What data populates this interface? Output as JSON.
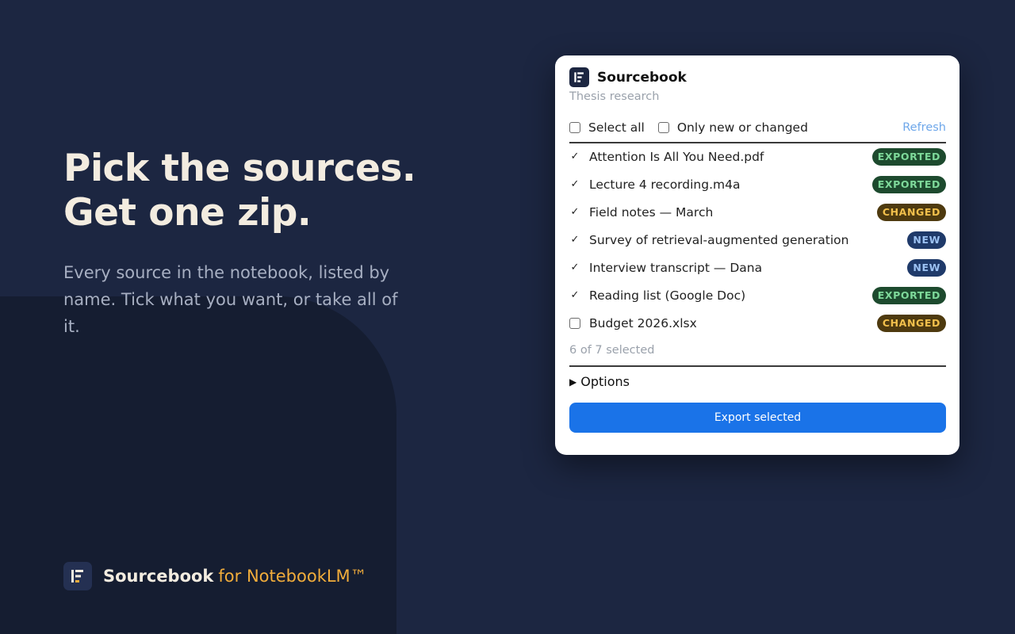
{
  "hero": {
    "title_line1": "Pick the sources.",
    "title_line2": "Get one zip.",
    "subtitle": "Every source in the notebook, listed by name. Tick what you want, or take all of it."
  },
  "brand": {
    "name": "Sourcebook",
    "suffix": "for NotebookLM™",
    "accent_color": "#f2ad3b"
  },
  "popup": {
    "title": "Sourcebook",
    "subtitle": "Thesis research",
    "toolbar": {
      "select_all_label": "Select all",
      "only_new_label": "Only new or changed",
      "refresh_label": "Refresh"
    },
    "sources": [
      {
        "name": "Attention Is All You Need.pdf",
        "checked": true,
        "status": "EXPORTED"
      },
      {
        "name": "Lecture 4 recording.m4a",
        "checked": true,
        "status": "EXPORTED"
      },
      {
        "name": "Field notes — March",
        "checked": true,
        "status": "CHANGED"
      },
      {
        "name": "Survey of retrieval-augmented generation",
        "checked": true,
        "status": "NEW"
      },
      {
        "name": "Interview transcript — Dana",
        "checked": true,
        "status": "NEW"
      },
      {
        "name": "Reading list (Google Doc)",
        "checked": true,
        "status": "EXPORTED"
      },
      {
        "name": "Budget 2026.xlsx",
        "checked": false,
        "status": "CHANGED"
      }
    ],
    "selection_count": "6 of 7 selected",
    "options_label": "Options",
    "export_label": "Export selected",
    "colors": {
      "primary": "#1a73e8",
      "exported_bg": "#1d4a2e",
      "changed_bg": "#4e3a0f",
      "new_bg": "#1f3a6a"
    }
  }
}
